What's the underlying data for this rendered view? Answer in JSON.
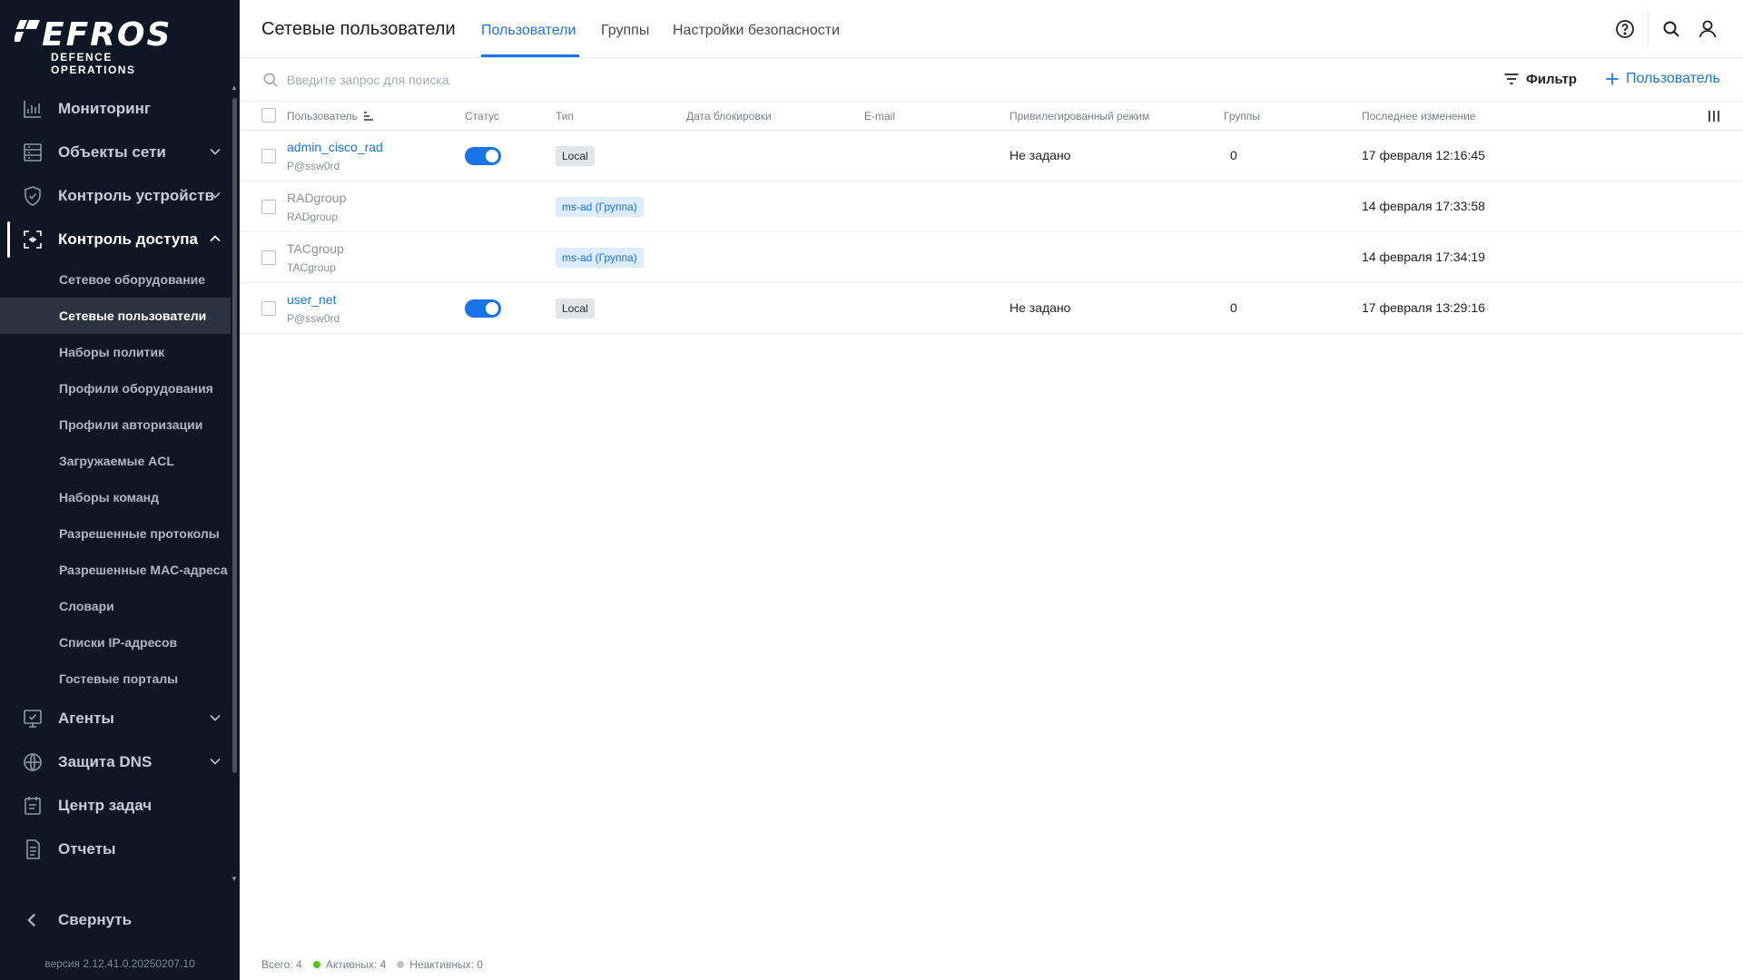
{
  "logo": {
    "main": "EFROS",
    "sub": "DEFENCE OPERATIONS"
  },
  "sidebar": {
    "items": [
      {
        "label": "Мониторинг",
        "icon": "chart-bars-icon"
      },
      {
        "label": "Объекты сети",
        "icon": "server-rack-icon"
      },
      {
        "label": "Контроль устройств",
        "icon": "shield-check-icon"
      },
      {
        "label": "Контроль доступа",
        "icon": "scan-frame-icon"
      },
      {
        "label": "Агенты",
        "icon": "monitor-check-icon"
      },
      {
        "label": "Защита DNS",
        "icon": "globe-icon"
      },
      {
        "label": "Центр задач",
        "icon": "calendar-icon"
      },
      {
        "label": "Отчеты",
        "icon": "document-icon"
      }
    ],
    "access_sub": [
      "Сетевое оборудование",
      "Сетевые пользователи",
      "Наборы политик",
      "Профили оборудования",
      "Профили авторизации",
      "Загружаемые ACL",
      "Наборы команд",
      "Разрешенные протоколы",
      "Разрешенные MAC-адреса",
      "Словари",
      "Списки IP-адресов",
      "Гостевые порталы"
    ],
    "collapse_label": "Свернуть",
    "version": "версия 2.12.41.0.20250207.10"
  },
  "header": {
    "title": "Сетевые пользователи",
    "tabs": [
      "Пользователи",
      "Группы",
      "Настройки безопасности"
    ],
    "active_tab": "Пользователи"
  },
  "toolbar": {
    "search_placeholder": "Введите запрос для поиска",
    "filter_label": "Фильтр",
    "add_label": "Пользователь"
  },
  "table": {
    "columns": [
      "Пользователь",
      "Статус",
      "Тип",
      "Дата блокировки",
      "E-mail",
      "Привилегированный режим",
      "Группы",
      "Последнее изменение"
    ],
    "rows": [
      {
        "name": "admin_cisco_rad",
        "sub": "P@ssw0rd",
        "status": "on",
        "type": "Local",
        "block_date": "",
        "email": "",
        "priv_mode": "Не задано",
        "groups": "0",
        "modified": "17 февраля 12:16:45"
      },
      {
        "name": "RADgroup",
        "sub": "RADgroup",
        "status": "",
        "type": "ms-ad (Группа)",
        "block_date": "",
        "email": "",
        "priv_mode": "",
        "groups": "",
        "modified": "14 февраля 17:33:58"
      },
      {
        "name": "TACgroup",
        "sub": "TACgroup",
        "status": "",
        "type": "ms-ad (Группа)",
        "block_date": "",
        "email": "",
        "priv_mode": "",
        "groups": "",
        "modified": "14 февраля 17:34:19"
      },
      {
        "name": "user_net",
        "sub": "P@ssw0rd",
        "status": "on",
        "type": "Local",
        "block_date": "",
        "email": "",
        "priv_mode": "Не задано",
        "groups": "0",
        "modified": "17 февраля 13:29:16"
      }
    ]
  },
  "footer": {
    "total": "Всего: 4",
    "active": "Активных: 4",
    "inactive": "Неактивных: 0",
    "active_color": "#52c41a",
    "inactive_color": "#bfc3c8"
  },
  "colors": {
    "accent": "#1a73e8",
    "sidebar_bg": "#0f1724"
  }
}
